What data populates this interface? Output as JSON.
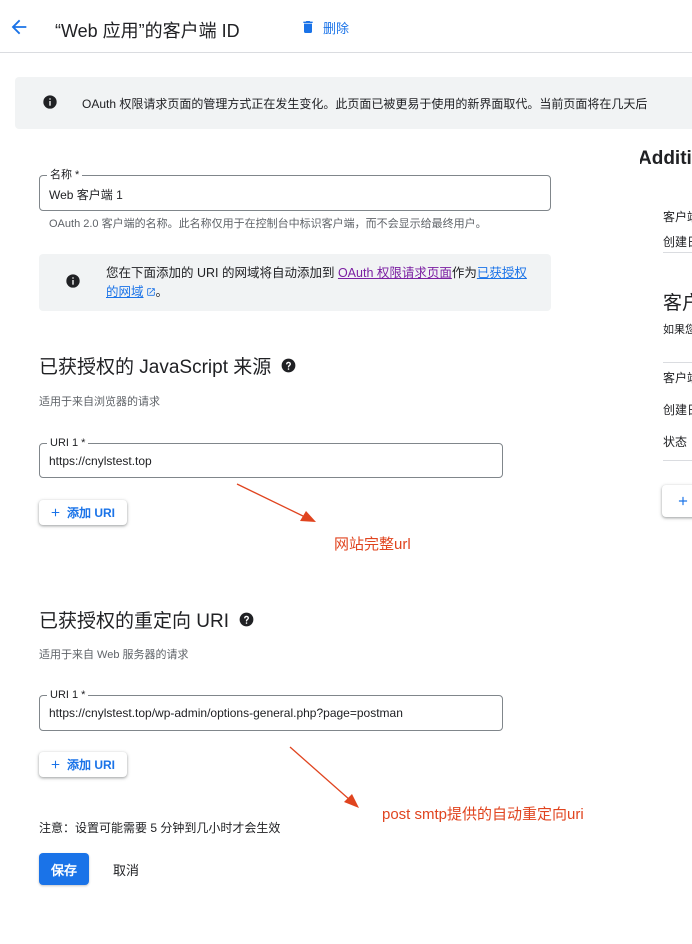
{
  "header": {
    "title": "“Web 应用”的客户端 ID",
    "delete_label": "删除",
    "icons": {
      "back": "arrow-back-icon",
      "delete": "trash-icon"
    }
  },
  "banner": {
    "text": "OAuth 权限请求页面的管理方式正在发生变化。此页面已被更易于使用的新界面取代。当前页面将在几天后"
  },
  "name_field": {
    "label": "名称 *",
    "value": "Web 客户端 1",
    "help": "OAuth 2.0 客户端的名称。此名称仅用于在控制台中标识客户端，而不会显示给最终用户。"
  },
  "info_box": {
    "text_before": "您在下面添加的 URI 的网域将自动添加到 ",
    "link1": "OAuth 权限请求页面",
    "text_middle": "作为",
    "link2": "已获授权的网域",
    "text_after": "。"
  },
  "js_origins": {
    "title": "已获授权的 JavaScript 来源",
    "subtitle": "适用于来自浏览器的请求",
    "uri_label": "URI 1 *",
    "uri_value": "https://cnylstest.top",
    "add_label": "添加 URI"
  },
  "redirect_uris": {
    "title": "已获授权的重定向 URI",
    "subtitle": "适用于来自 Web 服务器的请求",
    "uri_label": "URI 1 *",
    "uri_value": "https://cnylstest.top/wp-admin/options-general.php?page=postman",
    "add_label": "添加 URI"
  },
  "annotations": {
    "first": "网站完整url",
    "second": "post smtp提供的自动重定向uri",
    "color": "#e0441f"
  },
  "footer": {
    "note": "注意：设置可能需要 5 分钟到几小时才会生效",
    "save_label": "保存",
    "cancel_label": "取消"
  },
  "side_panel": {
    "title": "Additi",
    "rows_top": [
      "客户端",
      "创建日"
    ],
    "heading": "客户",
    "desc": "如果您",
    "rows_bottom": [
      "客户端",
      "创建日",
      "状态"
    ]
  },
  "colors": {
    "accent": "#1a73e8",
    "link_visited": "#7b1fa2",
    "banner_bg": "#f1f3f4"
  }
}
